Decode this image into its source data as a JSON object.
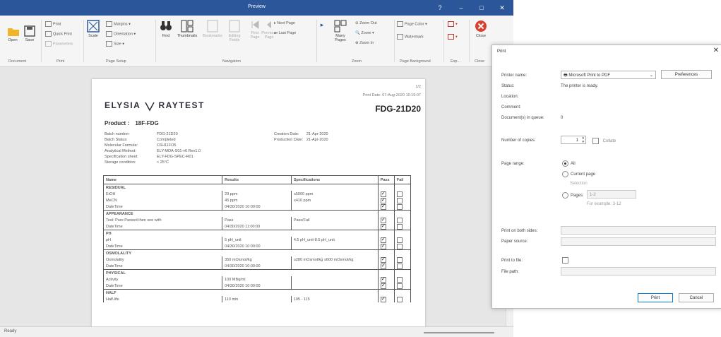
{
  "window": {
    "title": "Preview"
  },
  "ribbon": {
    "open": "Open",
    "save": "Save",
    "print": "Print",
    "quick_print": "Quick Print",
    "parameters": "Parameters",
    "scale": "Scale",
    "margins": "Margins",
    "orientation": "Orientation",
    "size": "Size",
    "find": "Find",
    "thumbnails": "Thumbnails",
    "bookmarks": "Bookmarks",
    "editing_fields": "Editing Fields",
    "first_page": "First Page",
    "previous_page": "Previous Page",
    "next_page": "Next Page",
    "last_page": "Last Page",
    "many_pages": "Many Pages",
    "zoom_out": "Zoom Out",
    "zoom": "Zoom",
    "zoom_in": "Zoom In",
    "page_color": "Page Color",
    "watermark": "Watermark",
    "export": "Export",
    "email": "E-Mail",
    "close": "Close",
    "groups": {
      "document": "Document",
      "print": "Print",
      "page_setup": "Page Setup",
      "navigation": "Navigation",
      "zoom": "Zoom",
      "page_background": "Page Background",
      "export": "Exp...",
      "close": "Close"
    }
  },
  "report": {
    "logo_left": "ELYSIA",
    "logo_right": "RAYTEST",
    "page_number": "1/2",
    "print_date": "Print Date: 07-Aug-2020 10:19:07",
    "doc_code": "FDG-21D20",
    "product_label": "Product :",
    "product_value": "18F-FDG",
    "meta_left": [
      [
        "Batch number:",
        "FDG-21D20"
      ],
      [
        "Batch Status:",
        "Completed"
      ],
      [
        "Molecular Formula:",
        "C6H11FO5"
      ],
      [
        "Analytical Method:",
        "ELY-MOA-S01-v6 Rev1.0"
      ],
      [
        "Specification sheet:",
        "ELY-FDG-SPEC-R01"
      ],
      [
        "Storage condition:",
        "< 25°C"
      ]
    ],
    "meta_right": [
      [
        "Creation Date:",
        "21-Apr-2020"
      ],
      [
        "Production Date:",
        "21-Apr-2020"
      ]
    ],
    "columns": [
      "Name",
      "Results",
      "Specifications",
      "Pass",
      "Fail"
    ],
    "groups": [
      {
        "name": "RESIDUAL",
        "rows": [
          {
            "name": "EtOH",
            "result": "29 ppm",
            "spec": "≤5000 ppm",
            "pass": true
          },
          {
            "name": "MeCN",
            "result": "45 ppm",
            "spec": "≤410 ppm",
            "pass": true
          },
          {
            "name": "DateTime",
            "result": "04/30/2020 10:00:00",
            "spec": "",
            "pass": true
          }
        ]
      },
      {
        "name": "APPEARANCE",
        "rows": [
          {
            "name": "Test: Pure Passed then see with",
            "result": "Pass",
            "spec": "Pass/Fail",
            "pass": true
          },
          {
            "name": "DateTime",
            "result": "04/30/2020 11:00:00",
            "spec": "",
            "pass": true
          }
        ]
      },
      {
        "name": "PH",
        "rows": [
          {
            "name": "pH",
            "result": "5 pH_unit",
            "spec": "4.5 pH_unit-8.5 pH_unit",
            "pass": true
          },
          {
            "name": "DateTime",
            "result": "04/30/2020 10:00:00",
            "spec": "",
            "pass": true
          }
        ]
      },
      {
        "name": "OSMOLALITY",
        "rows": [
          {
            "name": "Osmolality",
            "result": "350 mOsmol/kg",
            "spec": "≥280 mOsmol/kg ≤600 mOsmol/kg",
            "pass": true
          },
          {
            "name": "DateTime",
            "result": "04/30/2020 10:00:00",
            "spec": "",
            "pass": true
          }
        ]
      },
      {
        "name": "PHYSICAL",
        "rows": [
          {
            "name": "Activity",
            "result": "100 MBq/ml",
            "spec": "",
            "pass": true
          },
          {
            "name": "DateTime",
            "result": "04/30/2020 10:00:00",
            "spec": "",
            "pass": true
          }
        ]
      },
      {
        "name": "HALF",
        "rows": [
          {
            "name": "Half-life",
            "result": "110 min",
            "spec": "105 - 115",
            "pass": true
          }
        ]
      }
    ]
  },
  "status": {
    "left": "Ready"
  },
  "dialog": {
    "title": "Print",
    "printer_name_label": "Printer name:",
    "printer_name_value": "Microsoft Print to PDF",
    "preferences": "Preferences",
    "status_label": "Status:",
    "status_value": "The printer is ready.",
    "location_label": "Location:",
    "comment_label": "Comment:",
    "queue_label": "Document(s) in queue:",
    "queue_value": "0",
    "copies_label": "Number of copies:",
    "copies_value": "1",
    "collate": "Collate",
    "range_label": "Page range:",
    "range_all": "All",
    "range_current": "Current page",
    "range_selection": "Selection",
    "range_pages": "Pages:",
    "range_pages_value": "1-2",
    "range_example": "For example: 3-12",
    "duplex_label": "Print on both sides:",
    "source_label": "Paper source:",
    "to_file_label": "Print to file:",
    "file_path_label": "File path:",
    "print_btn": "Print",
    "cancel_btn": "Cancel"
  }
}
